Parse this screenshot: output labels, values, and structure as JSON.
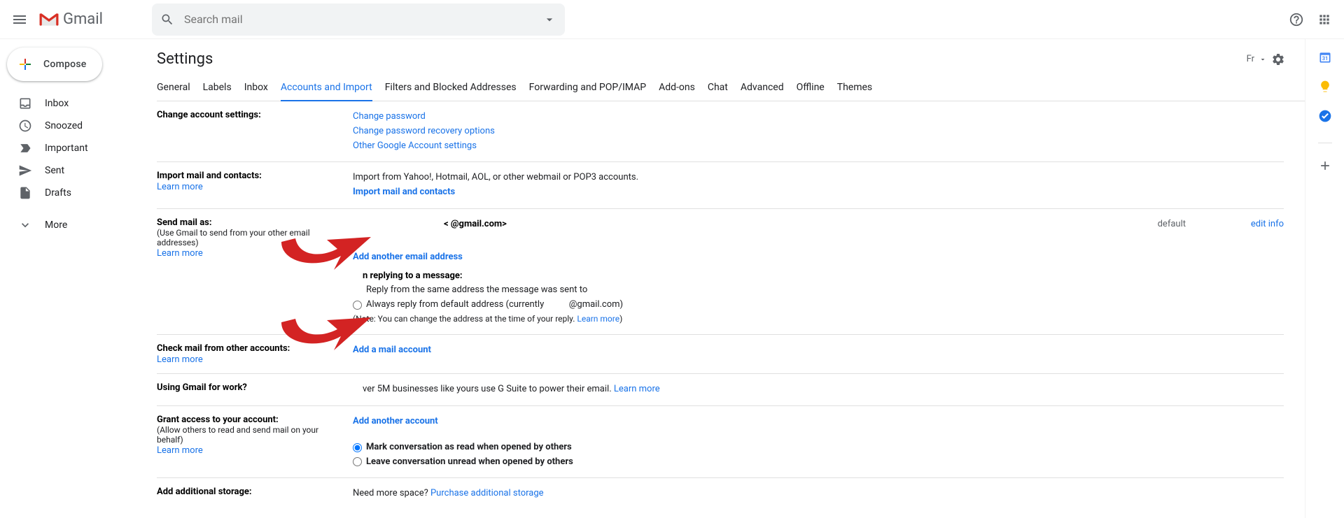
{
  "header": {
    "app_name": "Gmail",
    "search_placeholder": "Search mail"
  },
  "sidebar": {
    "compose": "Compose",
    "items": [
      "Inbox",
      "Snoozed",
      "Important",
      "Sent",
      "Drafts",
      "More"
    ]
  },
  "page": {
    "title": "Settings",
    "input_tools": "Fr"
  },
  "tabs": [
    "General",
    "Labels",
    "Inbox",
    "Accounts and Import",
    "Filters and Blocked Addresses",
    "Forwarding and POP/IMAP",
    "Add-ons",
    "Chat",
    "Advanced",
    "Offline",
    "Themes"
  ],
  "active_tab": 3,
  "sections": {
    "change": {
      "title": "Change account settings:",
      "links": [
        "Change password",
        "Change password recovery options",
        "Other Google Account settings"
      ]
    },
    "import": {
      "title": "Import mail and contacts:",
      "learn": "Learn more",
      "desc": "Import from Yahoo!, Hotmail, AOL, or other webmail or POP3 accounts.",
      "action": "Import mail and contacts"
    },
    "sendas": {
      "title": "Send mail as:",
      "sub": "(Use Gmail to send from your other email addresses)",
      "learn": "Learn more",
      "identity": "<                    @gmail.com>",
      "default": "default",
      "edit": "edit info",
      "add": "Add another email address",
      "reply_head": "n replying to a message:",
      "opt1": "Reply from the same address the message was sent to",
      "opt2_a": "Always reply from default address (currently ",
      "opt2_b": "@gmail.com)",
      "note_a": "(Note: You can change the address at the time of your reply. ",
      "note_link": "Learn more",
      "note_b": ")"
    },
    "check": {
      "title": "Check mail from other accounts:",
      "learn": "Learn more",
      "action": "Add a mail account"
    },
    "work": {
      "title": "Using Gmail for work?",
      "desc": "ver 5M businesses like yours use G Suite to power their email. ",
      "link": "Learn more"
    },
    "grant": {
      "title": "Grant access to your account:",
      "sub": "(Allow others to read and send mail on your behalf)",
      "learn": "Learn more",
      "action": "Add another account",
      "opt1": "Mark conversation as read when opened by others",
      "opt2": "Leave conversation unread when opened by others"
    },
    "storage": {
      "title": "Add additional storage:",
      "desc": "Need more space? ",
      "link": "Purchase additional storage"
    }
  }
}
